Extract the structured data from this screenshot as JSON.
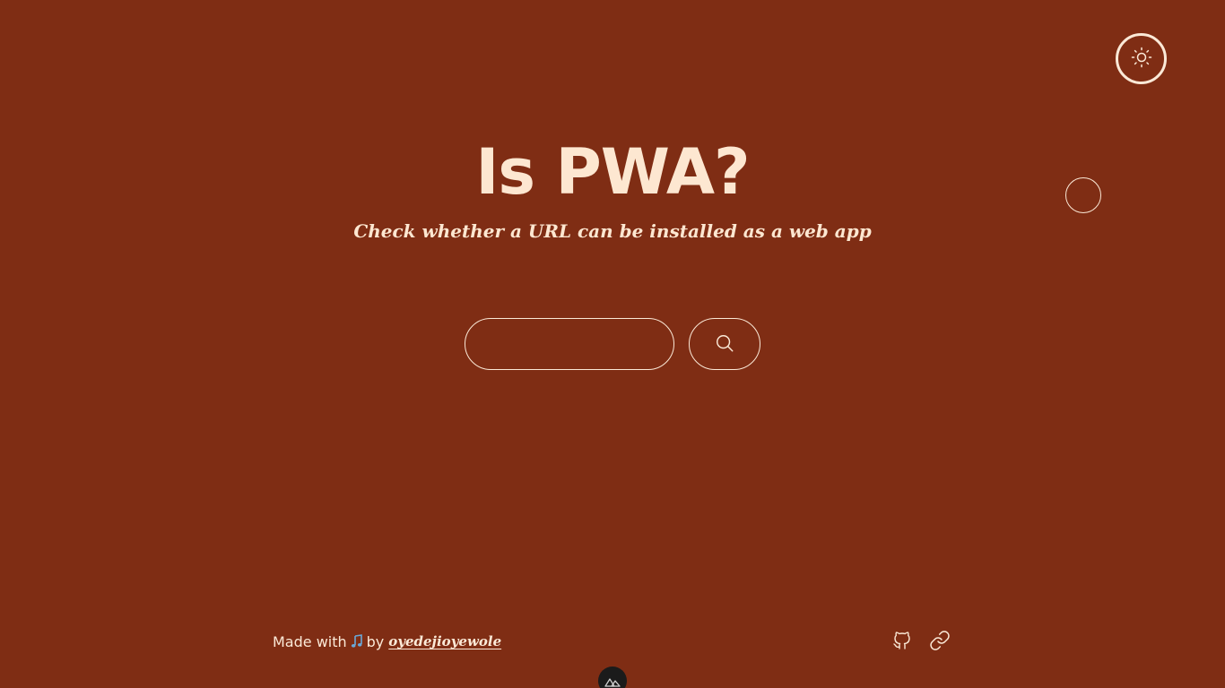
{
  "header": {
    "theme_toggle_icon": "sun-icon"
  },
  "hero": {
    "title": "Is PWA?",
    "subtitle": "Check whether a URL can be installed as a web app"
  },
  "search": {
    "input_value": "",
    "input_placeholder": "",
    "button_icon": "search-icon"
  },
  "footer": {
    "made_with": "Made with",
    "heart_icon": "music-note-icon",
    "by": "by",
    "author": "oyedejioyewole",
    "icons": [
      "github-icon",
      "link-icon"
    ]
  },
  "devtools": {
    "icon": "nuxt-logo-icon"
  },
  "colors": {
    "background": "#7f2d14",
    "foreground": "#fbe9d7",
    "badge": "#1b1b1b"
  }
}
